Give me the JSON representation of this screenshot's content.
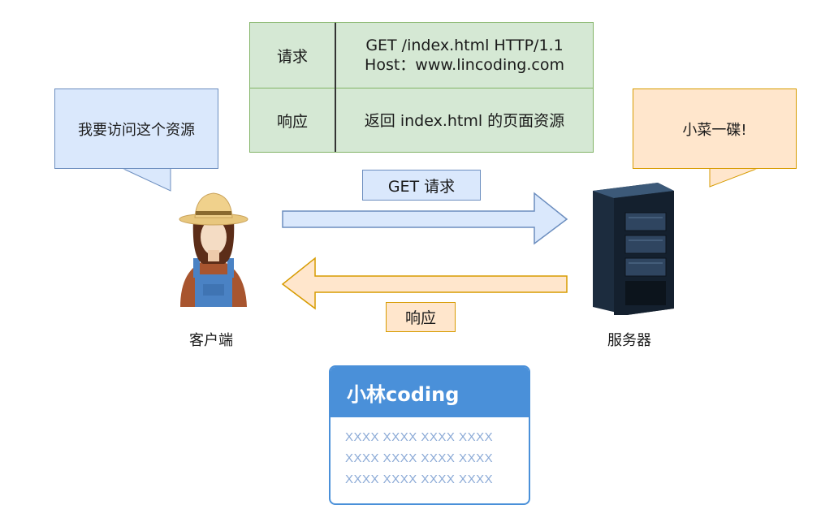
{
  "table": {
    "rows": [
      {
        "label": "请求",
        "lines": [
          "GET /index.html HTTP/1.1",
          "Host：www.lincoding.com"
        ]
      },
      {
        "label": "响应",
        "lines": [
          "返回 index.html 的页面资源"
        ]
      }
    ]
  },
  "client": {
    "speech": "我要访问这个资源",
    "caption": "客户端"
  },
  "server": {
    "speech": "小菜一碟!",
    "caption": "服务器"
  },
  "arrows": {
    "request_label": "GET 请求",
    "response_label": "响应"
  },
  "card": {
    "title": "小林coding",
    "lines": [
      "XXXX XXXX XXXX XXXX",
      "XXXX XXXX XXXX XXXX",
      "XXXX XXXX XXXX XXXX"
    ]
  },
  "colors": {
    "table_fill": "#d5e8d4",
    "table_stroke": "#82b366",
    "blue_fill": "#dae8fc",
    "blue_stroke": "#6c8ebf",
    "orange_fill": "#ffe6cc",
    "orange_stroke": "#d79b00",
    "card_accent": "#4a90d9"
  }
}
